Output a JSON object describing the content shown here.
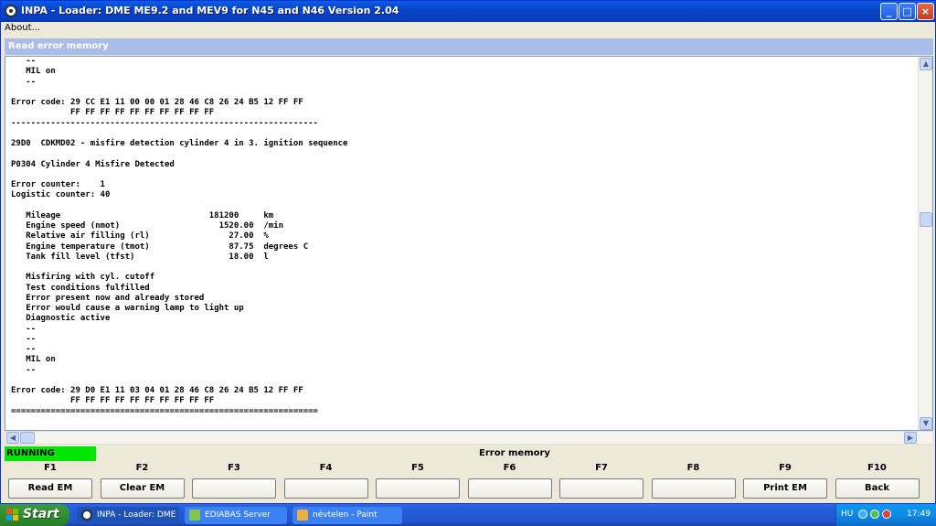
{
  "window": {
    "title": "INPA - Loader:  DME ME9.2 and MEV9 for N45 and N46 Version 2.04",
    "minimize": "_",
    "maximize": "□",
    "close": "×"
  },
  "menu": {
    "about": "About..."
  },
  "panel": {
    "title": "Read error memory"
  },
  "console_lines": [
    "   --",
    "   MIL on",
    "   --",
    "",
    "Error code: 29 CC E1 11 00 00 01 28 46 C8 26 24 B5 12 FF FF",
    "            FF FF FF FF FF FF FF FF FF FF",
    "--------------------------------------------------------------",
    "",
    "29D0  CDKMD02 - misfire detection cylinder 4 in 3. ignition sequence",
    "",
    "P0304 Cylinder 4 Misfire Detected",
    "",
    "Error counter:    1",
    "Logistic counter: 40",
    "",
    "   Mileage                              181200     km",
    "   Engine speed (nmot)                    1520.00  /min",
    "   Relative air filling (rl)                27.00  %",
    "   Engine temperature (tmot)                87.75  degrees C",
    "   Tank fill level (tfst)                   18.00  l",
    "",
    "   Misfiring with cyl. cutoff",
    "   Test conditions fulfilled",
    "   Error present now and already stored",
    "   Error would cause a warning lamp to light up",
    "   Diagnostic active",
    "   --",
    "   --",
    "   --",
    "   MIL on",
    "   --",
    "",
    "Error code: 29 D0 E1 11 03 04 01 28 46 C8 26 24 B5 12 FF FF",
    "            FF FF FF FF FF FF FF FF FF FF",
    "=============================================================="
  ],
  "status": {
    "state": "RUNNING",
    "label": "Error memory",
    "state_color": "#00e600"
  },
  "function_keys": [
    {
      "key": "F1",
      "label": "Read EM"
    },
    {
      "key": "F2",
      "label": "Clear EM"
    },
    {
      "key": "F3",
      "label": ""
    },
    {
      "key": "F4",
      "label": ""
    },
    {
      "key": "F5",
      "label": ""
    },
    {
      "key": "F6",
      "label": ""
    },
    {
      "key": "F7",
      "label": ""
    },
    {
      "key": "F8",
      "label": ""
    },
    {
      "key": "F9",
      "label": "Print EM"
    },
    {
      "key": "F10",
      "label": "Back"
    }
  ],
  "taskbar": {
    "start": "Start",
    "tasks": [
      {
        "label": "INPA - Loader:  DME ...",
        "icon": "inpa-icon"
      },
      {
        "label": "EDIABAS Server",
        "icon": "ediabas-icon"
      },
      {
        "label": "névtelen - Paint",
        "icon": "paint-icon"
      }
    ],
    "language": "HU",
    "clock": "17:49"
  }
}
